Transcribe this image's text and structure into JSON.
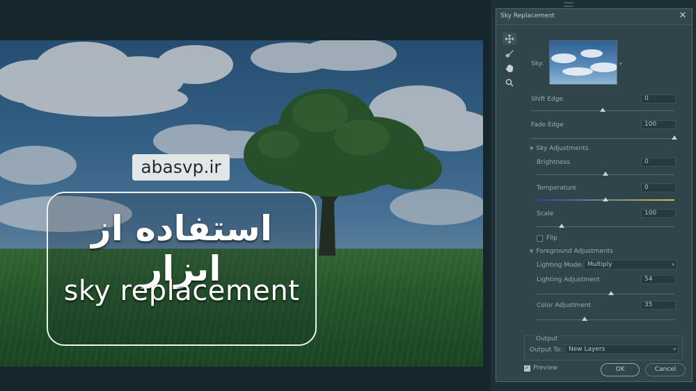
{
  "watermark": "abasvp.ir",
  "title": {
    "persian": "استفاده از ابزار",
    "english": "sky replacement"
  },
  "dialog": {
    "title": "Sky Replacement",
    "close_glyph": "✕",
    "tools": [
      "move-tool",
      "sky-brush-tool",
      "hand-tool",
      "zoom-tool"
    ],
    "sky_label": "Sky:",
    "shift_edge": {
      "label": "Shift Edge",
      "value": "0",
      "level": 0.5
    },
    "fade_edge": {
      "label": "Fade Edge",
      "value": "100",
      "level": 1.0
    },
    "sky_adjustments": {
      "header": "Sky Adjustments",
      "brightness": {
        "label": "Brightness",
        "value": "0",
        "level": 0.5
      },
      "temperature": {
        "label": "Temperature",
        "value": "0",
        "level": 0.5
      },
      "scale": {
        "label": "Scale",
        "value": "100",
        "level": 0.18
      },
      "flip_label": "Flip",
      "flip_checked": false
    },
    "foreground_adjustments": {
      "header": "Foreground Adjustments",
      "lighting_mode_label": "Lighting Mode:",
      "lighting_mode_value": "Multiply",
      "lighting_adjustment": {
        "label": "Lighting Adjustment",
        "value": "54",
        "level": 0.54
      },
      "color_adjustment": {
        "label": "Color Adjustment",
        "value": "35",
        "level": 0.35
      }
    },
    "output": {
      "header": "Output",
      "output_to_label": "Output To:",
      "output_to_value": "New Layers"
    },
    "preview_label": "Preview",
    "preview_checked": true,
    "ok_label": "OK",
    "cancel_label": "Cancel"
  },
  "colors": {
    "dialog_bg": "#2f444b",
    "temperature_cool": "#2c3fb0",
    "temperature_warm": "#d2c23a"
  }
}
